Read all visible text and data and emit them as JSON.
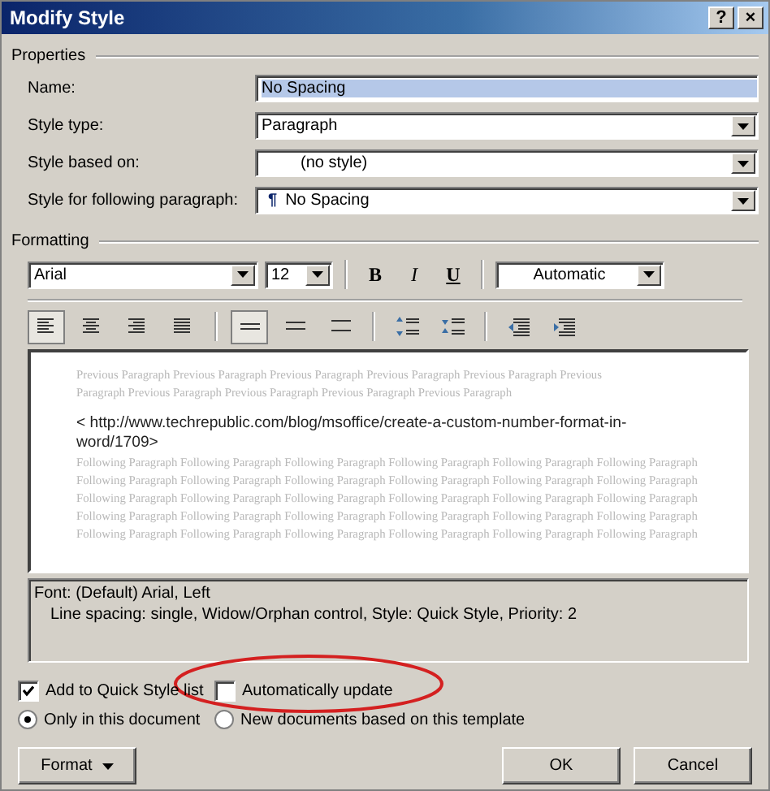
{
  "window": {
    "title": "Modify Style",
    "help": "?",
    "close": "×"
  },
  "properties": {
    "legend": "Properties",
    "fields": [
      {
        "label": "Name:",
        "value": "No Spacing",
        "kind": "text",
        "highlighted": true
      },
      {
        "label": "Style type:",
        "value": "Paragraph",
        "kind": "dropdown",
        "highlighted": false
      },
      {
        "label": "Style based on:",
        "value": "(no style)",
        "kind": "dropdown",
        "indented": true,
        "highlighted": false
      },
      {
        "label": "Style for following paragraph:",
        "value": "No Spacing",
        "kind": "dropdown",
        "mark": "¶",
        "highlighted": false
      }
    ]
  },
  "formatting": {
    "legend": "Formatting",
    "font": "Arial",
    "size": "12",
    "bold": "B",
    "italic": "I",
    "underline": "U",
    "font_color_setting": "Automatic",
    "alignment": [
      {
        "kind": "left",
        "selected": true
      },
      {
        "kind": "center",
        "selected": false
      },
      {
        "kind": "right",
        "selected": false
      },
      {
        "kind": "justify",
        "selected": false
      }
    ],
    "line_spacing": [
      {
        "kind": "single",
        "selected": true
      },
      {
        "kind": "one-half",
        "selected": false
      },
      {
        "kind": "double",
        "selected": false
      }
    ],
    "paragraph_spacing": [
      {
        "kind": "increase"
      },
      {
        "kind": "decrease"
      }
    ],
    "indent": [
      {
        "kind": "decrease"
      },
      {
        "kind": "increase"
      }
    ]
  },
  "preview": {
    "previous": [
      "Previous Paragraph Previous Paragraph Previous Paragraph Previous Paragraph Previous Paragraph Previous",
      "Paragraph Previous Paragraph Previous Paragraph Previous Paragraph Previous Paragraph"
    ],
    "sample": [
      "< http://www.techrepublic.com/blog/msoffice/create-a-custom-number-format-in-",
      "word/1709>"
    ],
    "following": [
      "Following Paragraph Following Paragraph Following Paragraph Following Paragraph Following Paragraph Following Paragraph",
      "Following Paragraph Following Paragraph Following Paragraph Following Paragraph Following Paragraph Following Paragraph",
      "Following Paragraph Following Paragraph Following Paragraph Following Paragraph Following Paragraph Following Paragraph",
      "Following Paragraph Following Paragraph Following Paragraph Following Paragraph Following Paragraph Following Paragraph",
      "Following Paragraph Following Paragraph Following Paragraph Following Paragraph Following Paragraph Following Paragraph"
    ]
  },
  "description": [
    "Font: (Default) Arial, Left",
    "Line spacing:  single, Widow/Orphan control, Style: Quick Style, Priority: 2"
  ],
  "checkboxes": [
    {
      "label": "Add to Quick Style list",
      "checked": true
    },
    {
      "label": "Automatically update",
      "checked": false
    }
  ],
  "radios": [
    {
      "label": "Only in this document",
      "selected": true
    },
    {
      "label": "New documents based on this template",
      "selected": false
    }
  ],
  "annotation": {
    "kind": "ellipse"
  },
  "buttons": {
    "format": "Format",
    "ok": "OK",
    "cancel": "Cancel"
  }
}
